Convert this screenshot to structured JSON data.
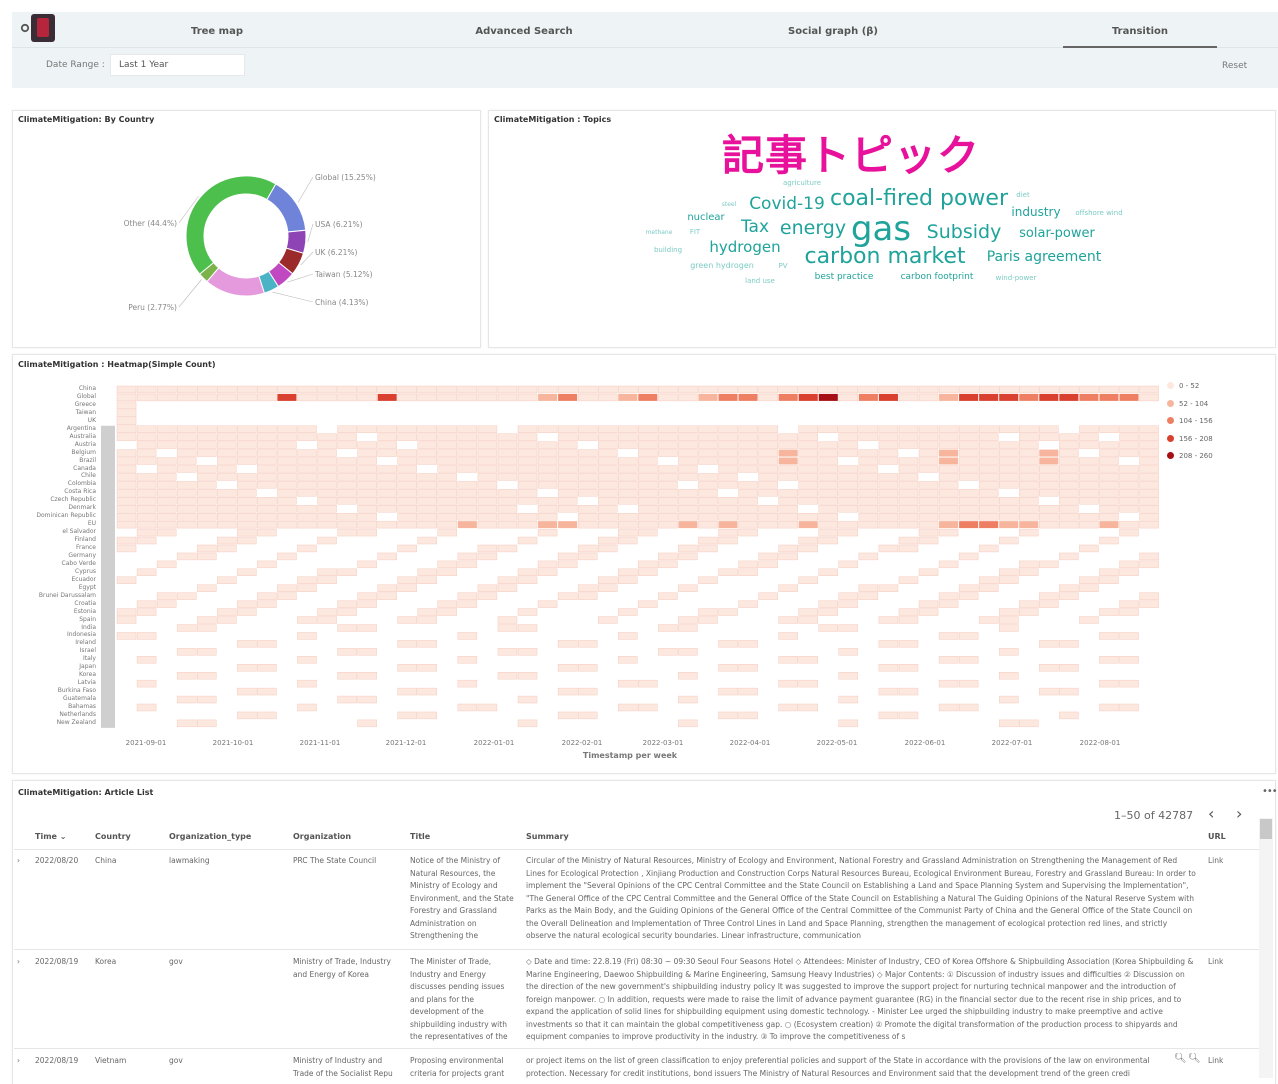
{
  "nav": {
    "tabs": [
      {
        "label": "Tree map"
      },
      {
        "label": "Advanced Search"
      },
      {
        "label": "Social graph (β)"
      },
      {
        "label": "Transition"
      }
    ],
    "active_tab": "Transition"
  },
  "filter": {
    "date_label": "Date Range :",
    "date_value": "Last 1 Year",
    "reset_label": "Reset"
  },
  "panels": {
    "by_country_title": "ClimateMitigation: By Country",
    "topics_title": "ClimateMitigation : Topics",
    "heatmap_title": "ClimateMitigation : Heatmap(Simple Count)",
    "articles_title": "ClimateMitigation: Article List"
  },
  "topics_overlay": "記事トピック",
  "chart_data": [
    {
      "type": "pie",
      "title": "ClimateMitigation: By Country",
      "slices": [
        {
          "label": "Global (15.25%)",
          "value": 15.25,
          "color": "#6f83d8"
        },
        {
          "label": "USA (6.21%)",
          "value": 6.21,
          "color": "#8e44b5"
        },
        {
          "label": "UK (6.21%)",
          "value": 6.21,
          "color": "#9b2a2a"
        },
        {
          "label": "Taiwan (5.12%)",
          "value": 5.12,
          "color": "#c048c0"
        },
        {
          "label": "China (4.13%)",
          "value": 4.13,
          "color": "#4ab3c5"
        },
        {
          "label": "Other slices (unlabeled)",
          "value": 16.3,
          "color": "#e59add"
        },
        {
          "label": "Peru (2.77%)",
          "value": 2.77,
          "color": "#7bb24a"
        },
        {
          "label": "Other (44.4%)",
          "value": 44.4,
          "color": "#4cbf4c"
        }
      ]
    },
    {
      "type": "heatmap",
      "title": "ClimateMitigation : Heatmap(Simple Count)",
      "xlabel": "Timestamp per week",
      "x_ticks": [
        "2021-09-01",
        "2021-10-01",
        "2021-11-01",
        "2021-12-01",
        "2022-01-01",
        "2022-02-01",
        "2022-03-01",
        "2022-04-01",
        "2022-05-01",
        "2022-06-01",
        "2022-07-01",
        "2022-08-01"
      ],
      "rows": [
        "China",
        "Global",
        "Greece",
        "Taiwan",
        "UK",
        "Argentina",
        "Australia",
        "Austria",
        "Belgium",
        "Brazil",
        "Canada",
        "Chile",
        "Colombia",
        "Costa Rica",
        "Czech Republic",
        "Denmark",
        "Dominican Republic",
        "EU",
        "el Salvador",
        "Finland",
        "France",
        "Germany",
        "Cabo Verde",
        "Cyprus",
        "Ecuador",
        "Egypt",
        "Brunei Darussalam",
        "Croatia",
        "Estonia",
        "Spain",
        "India",
        "Indonesia",
        "Ireland",
        "Israel",
        "Italy",
        "Japan",
        "Korea",
        "Latvia",
        "Burkina Faso",
        "Guatemala",
        "Bahamas",
        "Netherlands",
        "New Zealand"
      ],
      "legend": [
        {
          "label": "0 - 52",
          "color": "#fde8e0"
        },
        {
          "label": "52 - 104",
          "color": "#f6b59c"
        },
        {
          "label": "104 - 156",
          "color": "#ef7f63"
        },
        {
          "label": "156 - 208",
          "color": "#d9402f"
        },
        {
          "label": "208 - 260",
          "color": "#a50f15"
        }
      ]
    }
  ],
  "wordcloud": [
    {
      "text": "agriculture",
      "size": 7
    },
    {
      "text": "diet",
      "size": 7
    },
    {
      "text": "steel",
      "size": 6
    },
    {
      "text": "Covid-19",
      "size": 17
    },
    {
      "text": "coal-fired power",
      "size": 22
    },
    {
      "text": "industry",
      "size": 12
    },
    {
      "text": "offshore wind",
      "size": 7
    },
    {
      "text": "nuclear",
      "size": 10
    },
    {
      "text": "Tax",
      "size": 17
    },
    {
      "text": "energy",
      "size": 19
    },
    {
      "text": "gas",
      "size": 34
    },
    {
      "text": "Subsidy",
      "size": 19
    },
    {
      "text": "solar-power",
      "size": 13
    },
    {
      "text": "methane",
      "size": 6
    },
    {
      "text": "FIT",
      "size": 7
    },
    {
      "text": "hydrogen",
      "size": 15
    },
    {
      "text": "building",
      "size": 7
    },
    {
      "text": "green hydrogen",
      "size": 8
    },
    {
      "text": "PV",
      "size": 7
    },
    {
      "text": "carbon market",
      "size": 22
    },
    {
      "text": "Paris agreement",
      "size": 14
    },
    {
      "text": "land use",
      "size": 7
    },
    {
      "text": "best practice",
      "size": 9
    },
    {
      "text": "carbon footprint",
      "size": 9
    },
    {
      "text": "wind-power",
      "size": 7
    }
  ],
  "articles": {
    "pager_text": "1–50 of 42787",
    "columns": [
      "Time",
      "Country",
      "Organization_type",
      "Organization",
      "Title",
      "Summary",
      "URL"
    ],
    "rows": [
      {
        "time": "2022/08/20",
        "country": "China",
        "org_type": "lawmaking",
        "organization": "PRC The State Council",
        "title": "Notice of the Ministry of Natural Resources, the Ministry of Ecology and Environment, and the State Forestry and Grassland Administration on Strengthening the Management o",
        "summary": "Circular of the Ministry of Natural Resources, Ministry of Ecology and Environment, National Forestry and Grassland Administration on Strengthening the Management of Red Lines for Ecological Protection , Xinjiang Production and Construction Corps Natural Resources Bureau, Ecological Environment Bureau, Forestry and Grassland Bureau: In order to implement the \"Several Opinions of the CPC Central Committee and the State Council on Establishing a Land and Space Planning System and Supervising the Implementation\", \"The General Office of the CPC Central Committee and the General Office of the State Council on Establishing a Natural The Guiding Opinions of the Natural Reserve System with Parks as the Main Body, and the Guiding Opinions of the General Office of the Central Committee of the Communist Party of China and the General Office of the State Council on the Overall Delineation and Implementation of Three Control Lines in Land and Space Planning, strengthen the management of ecological protection red lines, and strictly observe the natural ecological security boundaries. Linear infrastructure, communication",
        "url": "Link"
      },
      {
        "time": "2022/08/19",
        "country": "Korea",
        "org_type": "gov",
        "organization": "Ministry of Trade, Industry and Energy of Korea",
        "title": "The Minister of Trade, Industry and Energy discusses pending issues and plans for the development of the shipbuilding industry with the representatives of the three shipbuildi",
        "summary": "◇ Date and time: 22.8.19 (Fri) 08:30 ~ 09:30 Seoul Four Seasons Hotel ◇ Attendees: Minister of Industry, CEO of Korea Offshore & Shipbuilding Association (Korea Shipbuilding & Marine Engineering, Daewoo Shipbuilding & Marine Engineering, Samsung Heavy Industries) ◇ Major Contents: ① Discussion of industry issues and difficulties ② Discussion on the direction of the new government's shipbuilding industry policy It was suggested to improve the support project for nurturing technical manpower and the introduction of foreign manpower. ○ In addition, requests were made to raise the limit of advance payment guarantee (RG) in the financial sector due to the recent rise in ship prices, and to expand the application of solid lines for shipbuilding equipment using domestic technology. - Minister Lee urged the shipbuilding industry to make preemptive and active investments so that it can maintain the global competitiveness gap. ○ (Ecosystem creation) ② Promote the digital transformation of the production process to shipyards and equipment companies to improve productivity in the industry. ③ To improve the competitiveness of s",
        "url": "Link"
      },
      {
        "time": "2022/08/19",
        "country": "Vietnam",
        "org_type": "gov",
        "organization": "Ministry of Industry and Trade of the Socialist Repu",
        "title": "Proposing environmental criteria for projects grant",
        "summary": "or project items on the list of green classification to enjoy preferential policies and support of the State in accordance with the provisions of the law on environmental protection. Necessary for credit institutions, bond issuers The Ministry of Natural Resources and Environment said that the development trend of the green credi",
        "url": "Link"
      }
    ]
  }
}
